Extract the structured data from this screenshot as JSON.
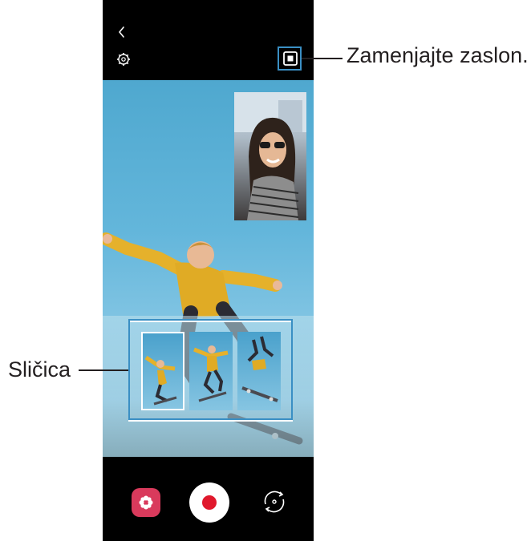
{
  "annotations": {
    "swap_screen": "Zamenjajte zaslon.",
    "thumbnail": "Sličica"
  },
  "icons": {
    "back": "chevron-left-icon",
    "settings": "gear-icon",
    "swap": "swap-screen-icon",
    "filter": "flower-icon",
    "record": "record-icon",
    "flip": "flip-camera-icon"
  },
  "colors": {
    "callout_box": "#3a8fc4",
    "record": "#e0182c",
    "filter_button": "#d93a5c",
    "sky": "#63b6db"
  }
}
